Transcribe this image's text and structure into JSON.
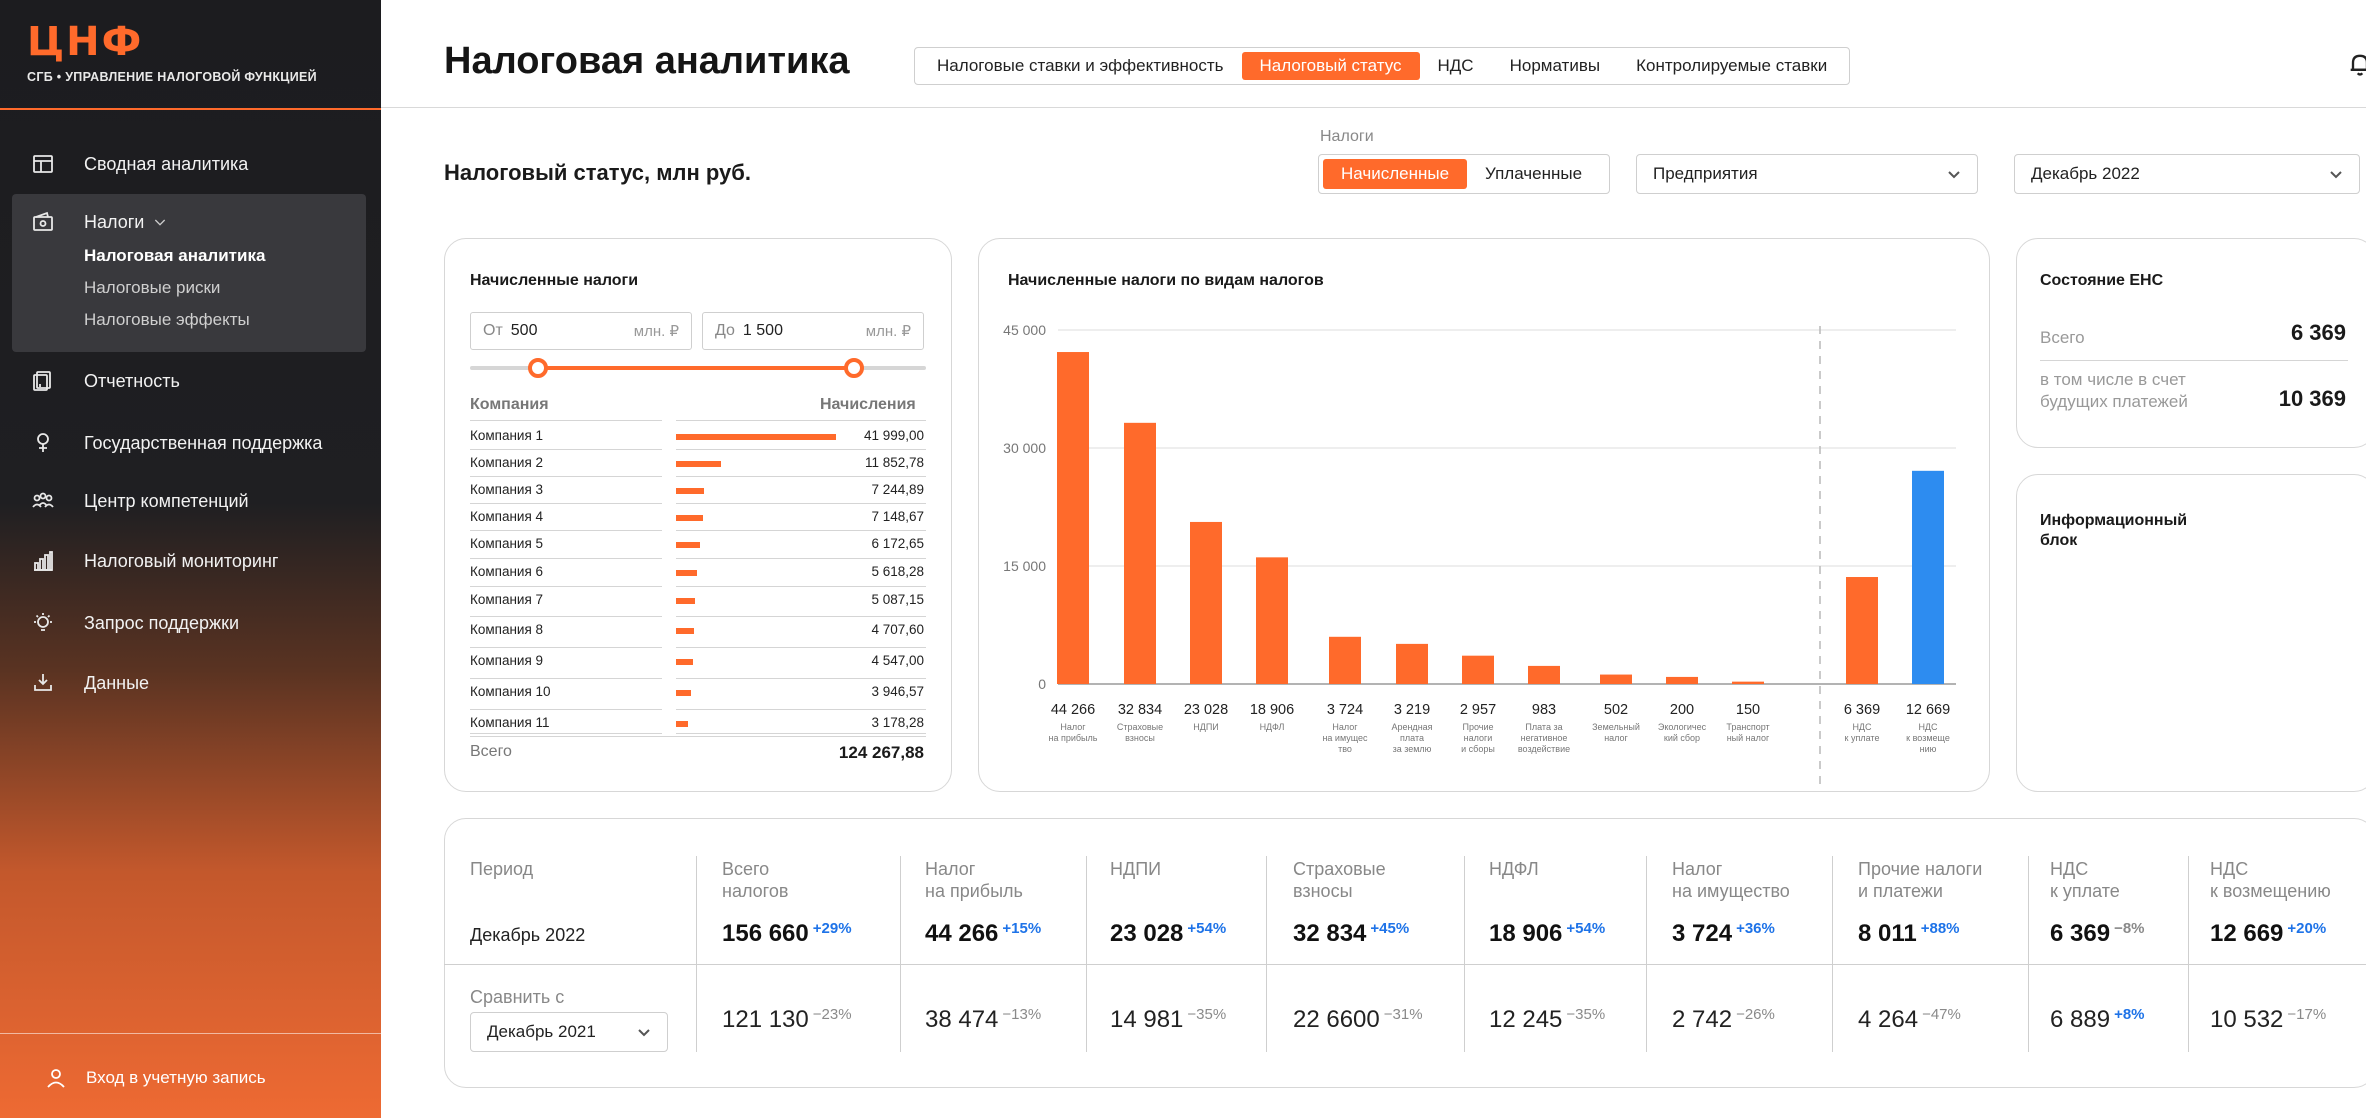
{
  "sidebar": {
    "logo": "ЦНФ",
    "logo_sub": "СГБ • УПРАВЛЕНИЕ НАЛОГОВОЙ ФУНКЦИЕЙ",
    "items": [
      {
        "label": "Сводная аналитика",
        "icon": "table-icon"
      },
      {
        "label": "Налоги",
        "icon": "wallet-icon"
      },
      {
        "label": "Отчетность",
        "icon": "report-icon"
      },
      {
        "label": "Государственная поддержка",
        "icon": "support-icon"
      },
      {
        "label": "Центр компетенций",
        "icon": "people-icon"
      },
      {
        "label": "Налоговый мониторинг",
        "icon": "bar-chart-icon"
      },
      {
        "label": "Запрос поддержки",
        "icon": "bulb-icon"
      },
      {
        "label": "Данные",
        "icon": "data-icon"
      }
    ],
    "sub_items": [
      "Налоговая аналитика",
      "Налоговые риски",
      "Налоговые эффекты"
    ],
    "login": "Вход в учетную запись"
  },
  "header": {
    "title": "Налоговая аналитика",
    "tabs": [
      "Налоговые ставки и эффективность",
      "Налоговый статус",
      "НДС",
      "Нормативы",
      "Контролируемые ставки"
    ]
  },
  "filters": {
    "section_title": "Налоговый статус, млн руб.",
    "label": "Налоги",
    "toggle": [
      "Начисленные",
      "Уплаченные"
    ],
    "entity": "Предприятия",
    "period": "Декабрь 2022"
  },
  "accrued": {
    "title": "Начисленные налоги",
    "from_label": "От",
    "from_value": "500",
    "to_label": "До",
    "to_value": "1 500",
    "unit": "млн. ₽",
    "col_company": "Компания",
    "col_value": "Начисления",
    "rows": [
      {
        "name": "Компания 1",
        "value": "41 999,00",
        "num": 41999.0
      },
      {
        "name": "Компания 2",
        "value": "11 852,78",
        "num": 11852.78
      },
      {
        "name": "Компания 3",
        "value": "7 244,89",
        "num": 7244.89
      },
      {
        "name": "Компания 4",
        "value": "7 148,67",
        "num": 7148.67
      },
      {
        "name": "Компания 5",
        "value": "6 172,65",
        "num": 6172.65
      },
      {
        "name": "Компания 6",
        "value": "5 618,28",
        "num": 5618.28
      },
      {
        "name": "Компания 7",
        "value": "5 087,15",
        "num": 5087.15
      },
      {
        "name": "Компания 8",
        "value": "4 707,60",
        "num": 4707.6
      },
      {
        "name": "Компания 9",
        "value": "4 547,00",
        "num": 4547.0
      },
      {
        "name": "Компания 10",
        "value": "3 946,57",
        "num": 3946.57
      },
      {
        "name": "Компания 11",
        "value": "3 178,28",
        "num": 3178.28
      }
    ],
    "total_label": "Всего",
    "total_value": "124 267,88"
  },
  "chart_data": {
    "type": "bar",
    "title": "Начисленные налоги по видам налогов",
    "ylim": [
      0,
      45000
    ],
    "yticks": [
      "0",
      "15 000",
      "30 000",
      "45 000"
    ],
    "ytick_values": [
      0,
      15000,
      30000,
      45000
    ],
    "categories": [
      [
        "Налог",
        "на прибыль"
      ],
      [
        "Страховые",
        "взносы"
      ],
      [
        "НДПИ"
      ],
      [
        "НДФЛ"
      ],
      [
        "Налог",
        "на имущес",
        "тво"
      ],
      [
        "Арендная",
        "плата",
        "за землю"
      ],
      [
        "Прочие",
        "налоги",
        "и сборы"
      ],
      [
        "Плата за",
        "негативное",
        "воздействие"
      ],
      [
        "Земельный",
        "налог"
      ],
      [
        "Экологичес",
        "кий сбор"
      ],
      [
        "Транспорт",
        "ный налог"
      ],
      [
        "НДС",
        "к уплате"
      ],
      [
        "НДС",
        "к возмеще",
        "нию"
      ]
    ],
    "values": [
      44266,
      32834,
      23028,
      18906,
      3724,
      3219,
      2957,
      983,
      502,
      200,
      150,
      6369,
      12669
    ],
    "value_labels": [
      "44 266",
      "32 834",
      "23 028",
      "18 906",
      "3 724",
      "3 219",
      "2 957",
      "983",
      "502",
      "200",
      "150",
      "6 369",
      "12 669"
    ],
    "bar_heights_shown": [
      42200,
      33200,
      20600,
      16100,
      6000,
      5100,
      3600,
      2300,
      1200,
      900,
      300,
      13600,
      27100
    ],
    "colors": [
      "#ff6a2b",
      "#ff6a2b",
      "#ff6a2b",
      "#ff6a2b",
      "#ff6a2b",
      "#ff6a2b",
      "#ff6a2b",
      "#ff6a2b",
      "#ff6a2b",
      "#ff6a2b",
      "#ff6a2b",
      "#ff6a2b",
      "#2d8cf0"
    ],
    "grid": true
  },
  "ens": {
    "title": "Состояние ЕНС",
    "total_label": "Всего",
    "total_value": "6 369",
    "future_label_1": "в том числе в счет",
    "future_label_2": "будущих платежей",
    "future_value": "10 369"
  },
  "info": {
    "title_1": "Информационный",
    "title_2": "блок"
  },
  "summary": {
    "period_label": "Период",
    "period_value": "Декабрь 2022",
    "compare_label": "Сравнить с",
    "compare_value": "Декабрь 2021",
    "columns": [
      {
        "h1": "Всего",
        "h2": "налогов",
        "v": "156 660",
        "d": "+29%",
        "cv": "121 130",
        "cd": "−23%"
      },
      {
        "h1": "Налог",
        "h2": "на прибыль",
        "v": "44 266",
        "d": "+15%",
        "cv": "38 474",
        "cd": "−13%"
      },
      {
        "h1": "НДПИ",
        "h2": "",
        "v": "23 028",
        "d": "+54%",
        "cv": "14 981",
        "cd": "−35%"
      },
      {
        "h1": "Страховые",
        "h2": "взносы",
        "v": "32 834",
        "d": "+45%",
        "cv": "22 6600",
        "cd": "−31%"
      },
      {
        "h1": "НДФЛ",
        "h2": "",
        "v": "18 906",
        "d": "+54%",
        "cv": "12 245",
        "cd": "−35%"
      },
      {
        "h1": "Налог",
        "h2": "на имущество",
        "v": "3 724",
        "d": "+36%",
        "cv": "2 742",
        "cd": "−26%"
      },
      {
        "h1": "Прочие налоги",
        "h2": "и платежи",
        "v": "8 011",
        "d": "+88%",
        "cv": "4 264",
        "cd": "−47%"
      },
      {
        "h1": "НДС",
        "h2": "к уплате",
        "v": "6 369",
        "d": "−8%",
        "cv": "6 889",
        "cd": "+8%"
      },
      {
        "h1": "НДС",
        "h2": "к возмещению",
        "v": "12 669",
        "d": "+20%",
        "cv": "10 532",
        "cd": "−17%"
      }
    ]
  },
  "colors": {
    "accent": "#ff6a2b",
    "positive": "#1e73e8",
    "neutral": "#8a8a8a",
    "blue_bar": "#2d8cf0"
  }
}
